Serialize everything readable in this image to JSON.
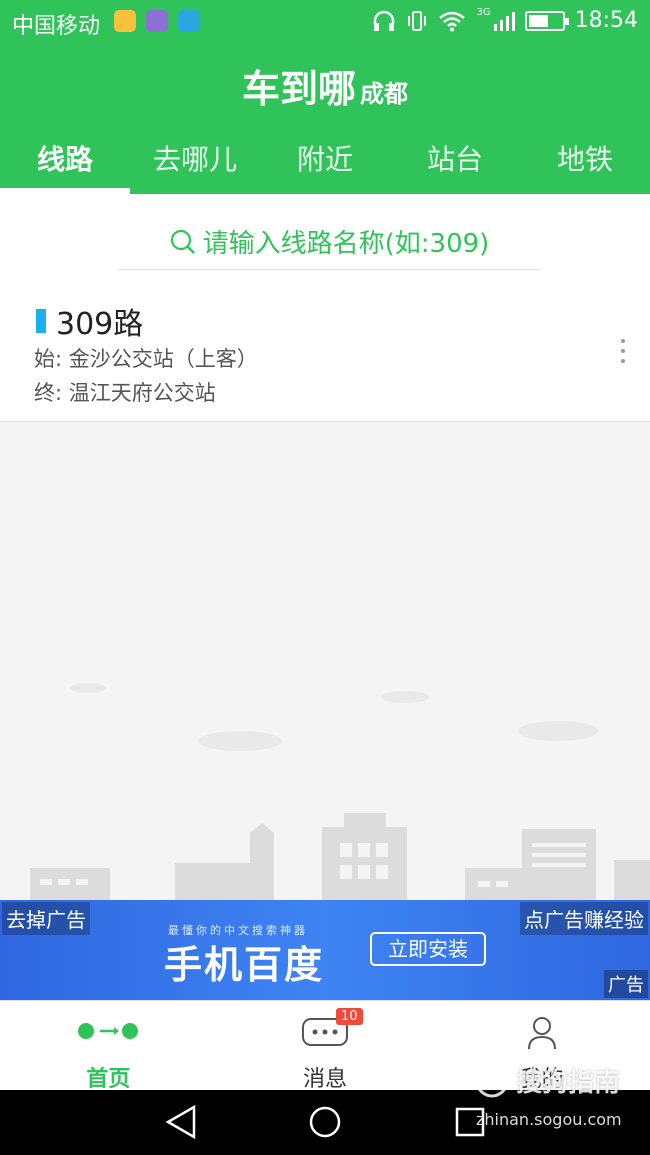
{
  "status_bar": {
    "carrier": "中国移动",
    "network": "3G",
    "time": "18:54",
    "battery_level": 0.6
  },
  "app": {
    "title": "车到哪",
    "city": "成都"
  },
  "tabs": [
    {
      "label": "线路",
      "active": true
    },
    {
      "label": "去哪儿",
      "active": false
    },
    {
      "label": "附近",
      "active": false
    },
    {
      "label": "站台",
      "active": false
    },
    {
      "label": "地铁",
      "active": false
    }
  ],
  "search": {
    "placeholder": "请输入线路名称(如:309)"
  },
  "route": {
    "name": "309路",
    "start": "始: 金沙公交站（上客）",
    "end": "终: 温江天府公交站"
  },
  "ad": {
    "remove_label": "去掉广告",
    "earn_label": "点广告赚经验",
    "tagline": "最懂你的中文搜索神器",
    "brand": "手机百度",
    "install_label": "立即安装",
    "ad_tag": "广告"
  },
  "bottom_nav": {
    "items": [
      {
        "label": "首页",
        "active": true
      },
      {
        "label": "消息",
        "active": false,
        "badge": "10"
      },
      {
        "label": "我的",
        "active": false
      }
    ]
  },
  "watermark": {
    "text": "搜狗指南",
    "url": "zhinan.sogou.com"
  },
  "colors": {
    "primary": "#2fc35a",
    "route_accent": "#1ab0f0",
    "ad_blue": "#3e84f3",
    "badge_red": "#f04a3a"
  }
}
